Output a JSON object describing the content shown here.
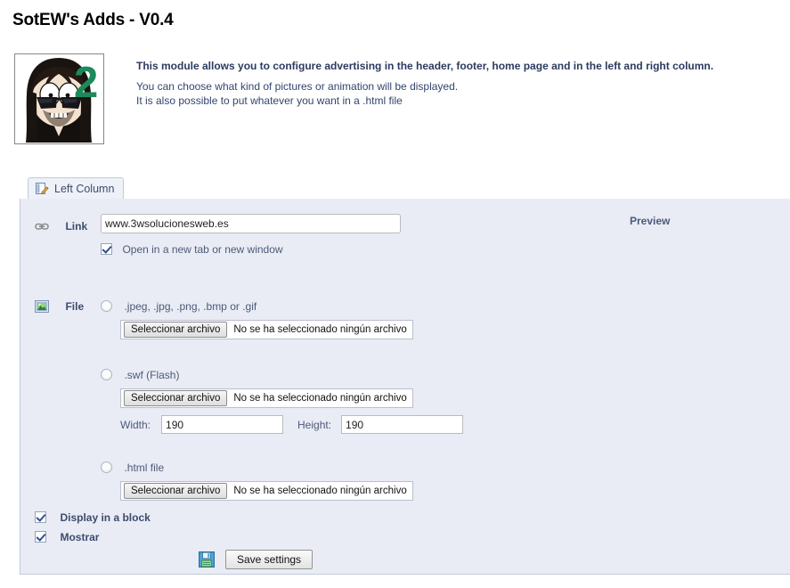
{
  "header": {
    "title": "SotEW's Adds - V0.4"
  },
  "intro": {
    "avatar_alt": "cartoon-avatar-with-green-two",
    "lines": [
      "This module allows you to configure advertising in the header, footer, home page and in the left and right column.",
      "You can choose what kind of pictures or animation will be displayed.",
      "It is also possible to put whatever you want in a .html file"
    ]
  },
  "tabs": [
    {
      "label": "Left Column",
      "icon": "edit-page-icon",
      "active": true
    }
  ],
  "form": {
    "link": {
      "icon": "chain-link-icon",
      "label": "Link",
      "value": "www.3wsolucionesweb.es",
      "placeholder": "",
      "new_tab_checkbox": {
        "label": "Open in a new tab or new window",
        "checked": true
      }
    },
    "file": {
      "icon": "picture-icon",
      "label": "File",
      "options": [
        {
          "radio_label": ".jpeg, .jpg, .png, .bmp or .gif",
          "selected": false,
          "browse_button": "Seleccionar archivo",
          "file_status": "No se ha seleccionado ningún archivo"
        },
        {
          "radio_label": ".swf (Flash)",
          "selected": false,
          "browse_button": "Seleccionar archivo",
          "file_status": "No se ha seleccionado ningún archivo",
          "width_label": "Width:",
          "width_value": "190",
          "height_label": "Height:",
          "height_value": "190"
        },
        {
          "radio_label": ".html file",
          "selected": false,
          "browse_button": "Seleccionar archivo",
          "file_status": "No se ha seleccionado ningún archivo"
        }
      ]
    },
    "display_block": {
      "label": "Display in a block",
      "checked": true
    },
    "mostrar": {
      "label": "Mostrar",
      "checked": true
    },
    "save": {
      "label": "Save settings",
      "icon": "floppy-disk-save-icon"
    }
  },
  "preview": {
    "label": "Preview"
  },
  "colors": {
    "panel_bg": "#e9ecf5",
    "panel_border": "#c3cadd",
    "label_text": "#3d4c6d",
    "focus_ring": "#e8a33d",
    "intro_text": "#33456e",
    "avatar_number": "#1c8a5a"
  }
}
